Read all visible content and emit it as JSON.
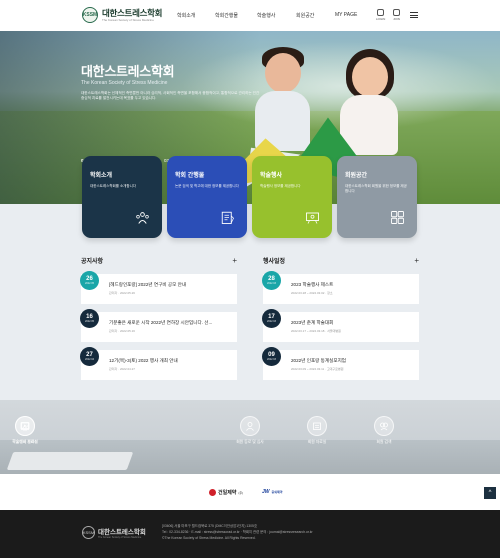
{
  "header": {
    "logo_mark": "KSSM",
    "logo_title": "대한스트레스학회",
    "logo_sub": "The Korean Society of Stress Medicine",
    "nav": [
      "학회소개",
      "학회간행물",
      "학술행사",
      "회원공간",
      "MY PAGE"
    ],
    "util": [
      {
        "label": "LOGIN",
        "icon": "login-icon"
      },
      {
        "label": "JOIN",
        "icon": "join-icon"
      }
    ],
    "menu_icon": "hamburger-icon"
  },
  "hero": {
    "title": "대한스트레스학회",
    "subtitle_en": "The Korean Society of Stress Medicine",
    "description": "대한스트레스학회는 신체적인 측면뿐만 아니라 심리적, 사회적인 측면을 포함해서 종합적이고, 통합적으로 관리하는 인간중심적 치료를 발전시키는데 목표를 두고 있습니다.",
    "pager_current": "01",
    "pager_total": "03",
    "prev_icon": "‹",
    "next_icon": "›",
    "pause_icon": "❚❚"
  },
  "cards": [
    {
      "title": "학회소개",
      "desc": "대한스트레스학회를 소개합니다",
      "color": "#1b3448",
      "icon": "people-icon"
    },
    {
      "title": "학회 간행물",
      "desc": "논문 검색 및 학고에 대한 정보를 제공합니다",
      "color": "#2b4eb7",
      "icon": "journal-icon"
    },
    {
      "title": "학술행사",
      "desc": "학술행사 정보를 제공합니다",
      "color": "#97c12d",
      "icon": "event-icon"
    },
    {
      "title": "회원공간",
      "desc": "대한스트레스학회 회원을 위한 정보를 제공합니다",
      "color": "#8f9aa4",
      "icon": "member-icon"
    }
  ],
  "notices": {
    "title": "공지사항",
    "more": "+",
    "items": [
      {
        "day": "26",
        "ym": "2022.05",
        "title": "[헤드랑인포랑] 2022년 연구비 공모 안내",
        "meta": "관리자 · 2022.05.26",
        "badge": "teal"
      },
      {
        "day": "16",
        "ym": "2022.05",
        "title": "기분좋은 새로운 시작 2022년 연하장 시안입니다. 선...",
        "meta": "관리자 · 2022.05.16",
        "badge": "navy"
      },
      {
        "day": "27",
        "ym": "2022.04",
        "title": "12기(목)-3(토) 2022 행사 개최 안내",
        "meta": "관리자 · 2022.04.27",
        "badge": "navy"
      }
    ]
  },
  "events": {
    "title": "행사일정",
    "more": "+",
    "items": [
      {
        "day": "28",
        "ym": "2022.03",
        "title": "2023 학술행사 제스트",
        "meta": "2022.03.28 ~ 2022.03.02 · 장소",
        "badge": "teal"
      },
      {
        "day": "17",
        "ym": "2022.03",
        "title": "2023년 춘계 학술대회",
        "meta": "2022.03.17 ~ 2022.03.18 · 서울대병원",
        "badge": "navy"
      },
      {
        "day": "09",
        "ym": "2022.03",
        "title": "2022년 인포랑 동계실포지엄",
        "meta": "2022.03.09 ~ 2022.03.11 · 고대구로병원",
        "badge": "navy"
      }
    ]
  },
  "quick_links": [
    {
      "label": "회원 등로 및 심사",
      "icon": "member-register-icon"
    },
    {
      "label": "회원 자료실",
      "icon": "archive-icon"
    },
    {
      "label": "회원 검색",
      "icon": "search-members-icon"
    },
    {
      "label": "학술행사 자료실",
      "icon": "video-icon"
    },
    {
      "label": "학술대회 갤러리",
      "icon": "gallery-icon"
    }
  ],
  "partners": [
    {
      "name": "건일제약",
      "suffix": "(주)"
    },
    {
      "name": "JW",
      "suffix": "중외제약"
    }
  ],
  "to_top": "^",
  "footer": {
    "logo_mark": "KSSM",
    "logo_title": "대한스트레스학회",
    "logo_sub": "The Korean Society of Stress Medicine",
    "lines": [
      "[03606] 서울 마포구 월드컵북로 375 (DMC이안상암1단지) 1305호",
      "Tel : 02-334-8236  ·  E-mail : stress@stressorad.or.kr  ·  학회지 관련 문의 : journal@stressresearch.or.kr",
      "©The Korean Society of Stress Medicine. All Rights Reserved."
    ]
  }
}
